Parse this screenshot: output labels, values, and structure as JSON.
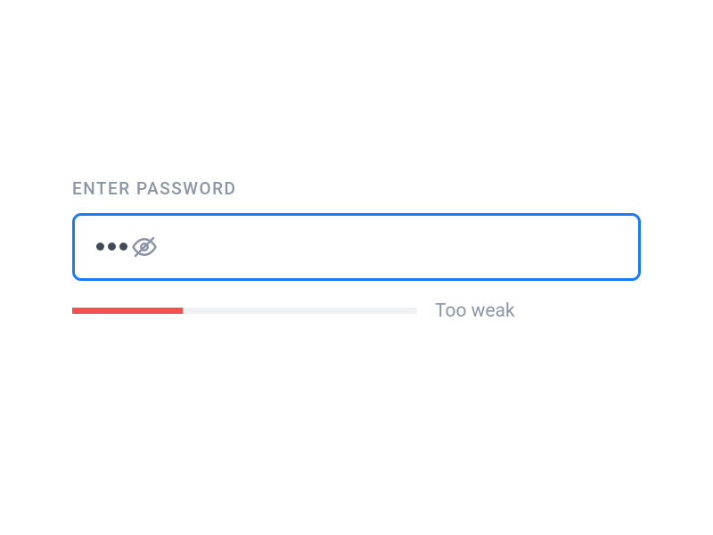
{
  "password": {
    "label": "ENTER PASSWORD",
    "masked_value": "•••",
    "char_count": 3,
    "strength": {
      "percent": 32,
      "label": "Too weak",
      "fill_color": "#f74f4f",
      "track_color": "#eff1f3"
    },
    "visibility_icon": "eye-off-icon",
    "border_color": "#1a7af8"
  }
}
